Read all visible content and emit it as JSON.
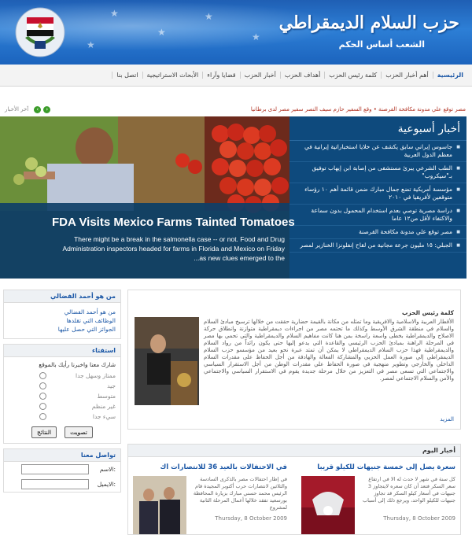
{
  "header": {
    "title": "حزب السلام الديمقراطي",
    "slogan": "الشعب أساس الحكم"
  },
  "nav": {
    "items": [
      "الرئيسية",
      "أهم أخبار الحزب",
      "كلمة رئيس الحزب",
      "أهداف الحزب",
      "أخبار الحزب",
      "قضايا وآراء",
      "الأبحاث الاستراتيجية",
      "اتصل بنا"
    ]
  },
  "ticker": {
    "text": "مصر توقع علي مدونة مكافحة القرصنة   •   وقع السفير حازم سيف النصر سفير مصر لدى برطانيا",
    "latest_label": "آخر الأخبار",
    "prev": "‹",
    "next": "›"
  },
  "hero": {
    "headline": "FDA Visits Mexico Farms Tainted Tomatoes",
    "summary": "There might be a break in the salmonella case -- or not. Food and Drug Administration inspectors headed for farms in Florida and Mexico on Friday ...as new clues emerged to the"
  },
  "weekly": {
    "title": "أخبار أسبوعية",
    "items": [
      "جاسوس إيراني سابق يكشف عن خلايا استخباراتية إيرانية في معظم الدول العربية",
      "الطب الشرعي يبرئ مستشفى من إصابة ابن إيهاب توفيق بـ\"سيكروب\"",
      "مؤسسة أمريكية تضع جمال مبارك ضمن قائمة أهم ١٠ رؤساء متوقعين لأفريقيا في ٢٠١٠",
      "دراسة مصرية توصي بعدم استخدام المحمول بدون سماعة والاكتفاء لأقل من١٢ عاما",
      "مصر توقع علي مدونة مكافحة القرصنة",
      "الجبلي: ١٥ مليون جرعة مجانية من لقاح إنفلونزا الخنازير لمصر"
    ]
  },
  "sidebar": {
    "founder": {
      "title": "من هو أحمد الفضالي",
      "links": [
        "من هو أحمد الفضالي",
        "الوظائف التي تقلدها",
        "الجوائز التي حصل عليها"
      ]
    },
    "poll": {
      "title": "استفتاء",
      "question": "شارك معنا واخبرنا رأيك بالموقع",
      "options": [
        "ممتاز وسهل جدا",
        "جيد",
        "متوسط",
        "غير منظم",
        "سيء جدا"
      ],
      "vote_label": "تصويت",
      "results_label": "النتائج"
    },
    "contact": {
      "title": "تواصل معنا",
      "name_label": "الاسم:",
      "email_label": "الايميل:"
    }
  },
  "president": {
    "box_title": "كلمة رئيس الحزب",
    "body": "الأقطار العربية والاسلامية والافريقية وما تمثله من مكانة بالقيمة حضارية حققت من خلالها ترسيخ مبادئ السلام والسلام في منطقة الشرق الأوسط وكذلك ما تحتمه مصر من اجراءات ديمقراطية متوازنة وانطلاق حركة الاصلاح والديمقراطية بخطى واسعة راسخة بمن هنا كانت مفاهيم السلام والديمقراطية والتي تحمي بها مصر في المرحلة الراهنة بمبادئ الحزب الرئيسي والقاعدة التي يدعو إليها حتى يكون رائداً من رواد السلام والديمقراطية فهذا حزب السلام الديمقراطي لا يمكن أن تمتد عبرة نحو بعيد من مؤسسو حزب السلام الديمقراطي إلي صورة العمل الحزبي والمشاركة الفعالة والهادفة من أجل الحفاظ على مقدرات السلام الداخلي والخارجي وتطوير منهجية في صورة الحفاظ علي مقدرات الوطن من أجل الاستقرار السياسي والاجتماعي التي تسعى مصر في التعزيز من خلال مرحلة جديدة يقوم في الاستقرار السياسي والاجتماعي والأمن والسلام الاجتماعي لمصر.",
    "more_label": "المزيد"
  },
  "today": {
    "title": "أخبار اليوم",
    "items": [
      {
        "headline": "سعرة يصل إلى خمسة جنيهات للكيلو قريبا",
        "text": "كل سنة في شهر لا حدث له الا في ارتفاع سعر السكر فتعد أن كان سعره لايتجاوز 3 جنيهات في أسعار كيلو السكر قد تجاوز جنيهات للكيلو الواحد، ويرجع ذلك إلى أسباب",
        "date": "Thursday, 8 October 2009"
      },
      {
        "headline": "في الاحتفالات بالعيد 36 للانتصارات أك",
        "text": "في إطار احتفالات مصر بالذكرى السادسة والثلاثين لانتصارات حرب أكتوبر المجيدة قام الرئيس محمد حسني مبارك بزيارة المحافظة بورسعيد تفقد خلالها أعمال المرحلة الثانية لمشروع",
        "date": "Thursday, 8 October 2009"
      }
    ]
  },
  "colors": {
    "header_blue": "#1f5fb4",
    "panel_blue": "#0e4a7d",
    "link_blue": "#1b57a6",
    "ticker_red": "#b03020"
  }
}
